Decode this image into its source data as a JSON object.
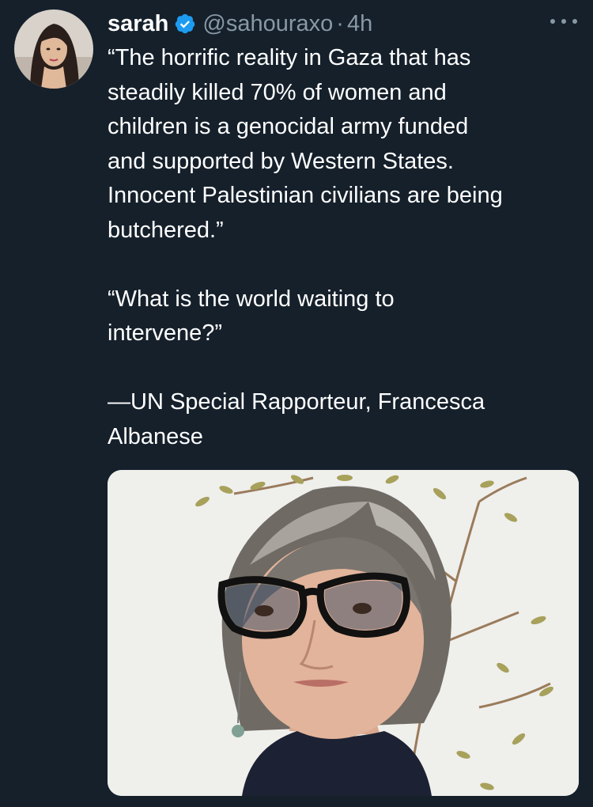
{
  "tweet": {
    "author": {
      "name": "sarah",
      "handle": "@sahouraxo",
      "separator": "·",
      "time": "4h",
      "verified": true
    },
    "text": {
      "p1_l1": "“The horrific reality in Gaza that has",
      "p1_l2": "steadily killed 70% of women and",
      "p1_l3": "children is a genocidal army funded",
      "p1_l4": "and supported by Western States.",
      "p1_l5": "Innocent Palestinian civilians are being",
      "p1_l6": "butchered.”",
      "p2_l1": "“What is the world waiting to",
      "p2_l2": "intervene?”",
      "p3_l1": "—UN Special Rapporteur, Francesca",
      "p3_l2": "Albanese"
    },
    "icons": {
      "verified": "verified-badge-icon",
      "more": "more-options-icon"
    },
    "colors": {
      "background": "#15202b",
      "text": "#ffffff",
      "muted": "#8899a6",
      "verified": "#1d9bf0"
    }
  }
}
